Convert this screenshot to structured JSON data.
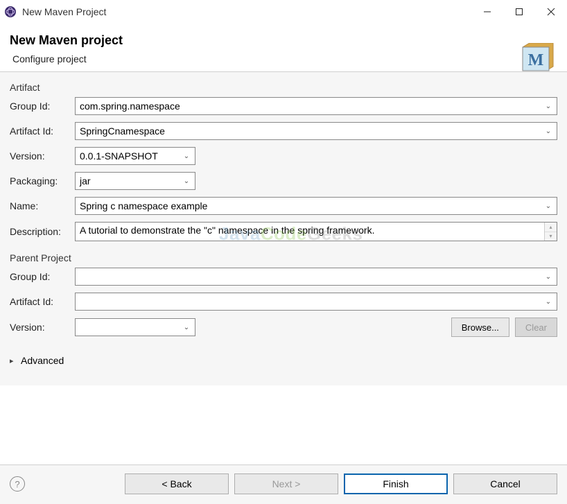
{
  "window": {
    "title": "New Maven Project"
  },
  "header": {
    "title": "New Maven project",
    "subtitle": "Configure project"
  },
  "artifact": {
    "legend": "Artifact",
    "groupIdLabel": "Group Id:",
    "groupId": "com.spring.namespace",
    "artifactIdLabel": "Artifact Id:",
    "artifactId": "SpringCnamespace",
    "versionLabel": "Version:",
    "version": "0.0.1-SNAPSHOT",
    "packagingLabel": "Packaging:",
    "packaging": "jar",
    "nameLabel": "Name:",
    "name": "Spring c namespace example",
    "descriptionLabel": "Description:",
    "description": "A tutorial to demonstrate the \"c\" namespace in the spring framework."
  },
  "parent": {
    "legend": "Parent Project",
    "groupIdLabel": "Group Id:",
    "groupId": "",
    "artifactIdLabel": "Artifact Id:",
    "artifactId": "",
    "versionLabel": "Version:",
    "version": "",
    "browseLabel": "Browse...",
    "clearLabel": "Clear"
  },
  "advanced": {
    "label": "Advanced"
  },
  "footer": {
    "back": "< Back",
    "next": "Next >",
    "finish": "Finish",
    "cancel": "Cancel"
  },
  "watermark": {
    "part1": "Java",
    "part2": "Code",
    "part3": "Geeks"
  }
}
